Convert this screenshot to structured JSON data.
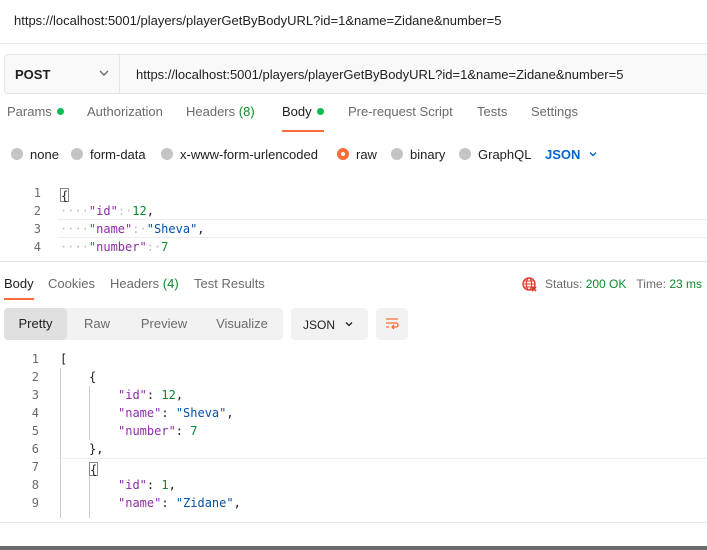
{
  "window": {
    "title": "https://localhost:5001/players/playerGetByBodyURL?id=1&name=Zidane&number=5"
  },
  "request": {
    "method": "POST",
    "url": "https://localhost:5001/players/playerGetByBodyURL?id=1&name=Zidane&number=5"
  },
  "request_tabs": {
    "params": "Params",
    "authorization": "Authorization",
    "headers": "Headers",
    "headers_count": "(8)",
    "body": "Body",
    "prerequest": "Pre-request Script",
    "tests": "Tests",
    "settings": "Settings"
  },
  "body_types": {
    "none": "none",
    "form_data": "form-data",
    "urlencoded": "x-www-form-urlencoded",
    "raw": "raw",
    "binary": "binary",
    "graphql": "GraphQL",
    "language": "JSON"
  },
  "request_body": {
    "line_numbers": [
      "1",
      "2",
      "3",
      "4"
    ],
    "open_brace": "{",
    "key_id": "\"id\"",
    "val_id": "12",
    "key_name": "\"name\"",
    "val_name": "\"Sheva\"",
    "key_number": "\"number\"",
    "val_number": "7",
    "indent": "····",
    "colon_space": ":·",
    "comma": ","
  },
  "response_tabs": {
    "body": "Body",
    "cookies": "Cookies",
    "headers": "Headers",
    "headers_count": "(4)",
    "test_results": "Test Results"
  },
  "response_status": {
    "status_label": "Status:",
    "status_value": "200 OK",
    "time_label": "Time:",
    "time_value": "23 ms"
  },
  "view_modes": {
    "pretty": "Pretty",
    "raw": "Raw",
    "preview": "Preview",
    "visualize": "Visualize",
    "format": "JSON"
  },
  "response_body": {
    "line_numbers": [
      "1",
      "2",
      "3",
      "4",
      "5",
      "6",
      "7",
      "8",
      "9"
    ],
    "open_bracket": "[",
    "open_brace": "{",
    "close_brace_comma": "},",
    "key_id": "\"id\"",
    "val_id_1": "12",
    "key_name": "\"name\"",
    "val_name_1": "\"Sheva\"",
    "key_number": "\"number\"",
    "val_number_1": "7",
    "val_id_2": "1",
    "val_name_2": "\"Zidane\"",
    "colon": ": ",
    "comma": ","
  },
  "colors": {
    "accent": "#ff6c37",
    "ok_green": "#0d8a2c",
    "dot_green": "#0cbb52",
    "link_blue": "#0265d2",
    "json_key": "#8e2ca8",
    "json_string": "#0451a5"
  },
  "icons": {
    "method_dropdown": "chevron-down-icon",
    "language_dropdown": "chevron-down-icon",
    "network": "globe-icon",
    "format_dropdown": "chevron-down-icon",
    "wrap": "wrap-lines-icon"
  }
}
